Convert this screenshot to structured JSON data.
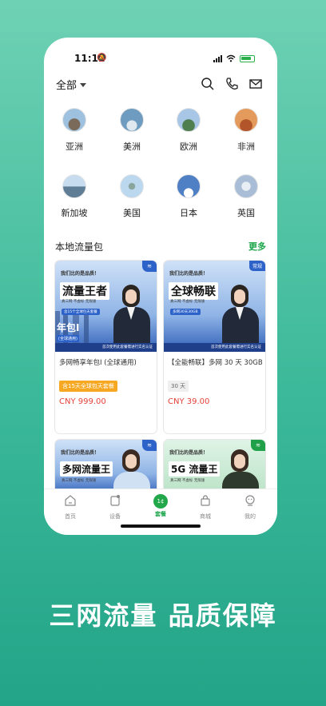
{
  "status": {
    "time": "11:11"
  },
  "header": {
    "region": "全部"
  },
  "regions": [
    {
      "label": "亚洲",
      "color": "#6d8fb0"
    },
    {
      "label": "美洲",
      "color": "#7aa6c9"
    },
    {
      "label": "欧洲",
      "color": "#5c8f6a"
    },
    {
      "label": "非洲",
      "color": "#c4683a"
    },
    {
      "label": "新加坡",
      "color": "#9bb9d8"
    },
    {
      "label": "美国",
      "color": "#a8cbe8"
    },
    {
      "label": "日本",
      "color": "#5a86c6"
    },
    {
      "label": "英国",
      "color": "#c9d7e6"
    }
  ],
  "section": {
    "title": "本地流量包",
    "more": "更多"
  },
  "cards": [
    {
      "slogan": "我们比的是品质！",
      "title": "流量王者",
      "tags": "真三网   不虚标   无限速",
      "ribbon": "含15个全球包天套餐",
      "year": "年包I",
      "year_sub": "(全球通用)",
      "notice": "首次使用此套餐需进行实名认证",
      "name": "多网畅享年包I (全球通用)",
      "tag": "含15天全球包天套餐",
      "price": "CNY 999.00"
    },
    {
      "slogan": "我们比的是品质！",
      "title": "全球畅联",
      "badge": "常规",
      "tags": "真三网   不虚标   无限速",
      "ribbon": "多网30天30GB",
      "notice": "首次使用此套餐需进行实名认证",
      "name": "【全能畅联】多网 30 天 30GB",
      "tag": "30 天",
      "price": "CNY 39.00"
    },
    {
      "slogan": "我们比的是品质！",
      "title": "多网流量王",
      "tags": "真三网   不虚标   无限速"
    },
    {
      "slogan": "我们比的是品质！",
      "title": "5G 流量王",
      "tags": "真三网   不虚标   无限速"
    }
  ],
  "tabs": [
    {
      "label": "首页"
    },
    {
      "label": "设备"
    },
    {
      "label": "套餐",
      "icon_text": "1¢"
    },
    {
      "label": "商城"
    },
    {
      "label": "我的"
    }
  ],
  "tagline": "三网流量  品质保障",
  "accent": "#1aa54a"
}
